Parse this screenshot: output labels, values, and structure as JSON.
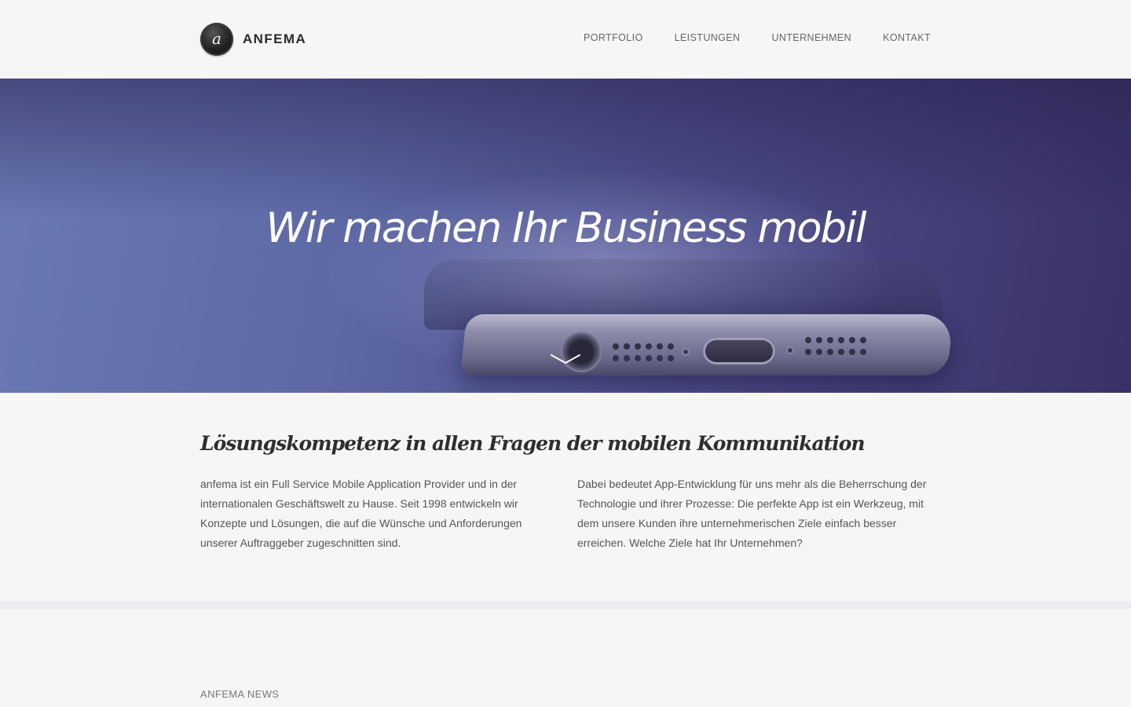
{
  "brand": {
    "name": "ANFEMA",
    "logo_letter": "a"
  },
  "nav": {
    "items": [
      {
        "label": "PORTFOLIO"
      },
      {
        "label": "LEISTUNGEN"
      },
      {
        "label": "UNTERNEHMEN"
      },
      {
        "label": "KONTAKT"
      }
    ]
  },
  "hero": {
    "title": "Wir machen Ihr Business mobil",
    "scroll_icon": "chevron-down-icon"
  },
  "intro": {
    "title": "Lösungskompetenz in allen Fragen der mobilen Kommunikation",
    "left_text": "anfema ist ein Full Service Mobile Application Provider und in der internationalen Geschäftswelt zu Hause. Seit 1998 entwickeln wir Konzepte und Lösungen, die auf die Wünsche und Anforderungen unserer Auftraggeber zugeschnitten sind.",
    "right_text": "Dabei bedeutet App-Entwicklung für uns mehr als die Beherrschung der Technologie und ihrer Prozesse: Die perfekte App ist ein Werkzeug, mit dem unsere Kunden ihre unternehmerischen Ziele einfach besser erreichen. Welche Ziele hat Ihr Unternehmen?"
  },
  "news": {
    "label": "ANFEMA NEWS"
  }
}
